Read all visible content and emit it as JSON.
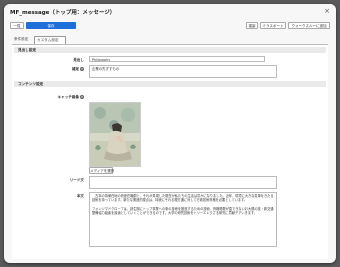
{
  "window": {
    "title": "MF_message（トップ用：メッセージ）",
    "close_glyph": "×"
  },
  "toolbar": {
    "left_buttons": [
      "一覧",
      "保存"
    ],
    "right_buttons": [
      "複製",
      "ミラスポート",
      "ウォークスルーに追加"
    ]
  },
  "tabs": [
    "条件設定",
    "カスタム設定"
  ],
  "sections": {
    "heading_section": "見出し設定",
    "content_section": "コンテンツ設定"
  },
  "fields": {
    "midashi_label": "見出し",
    "midashi_value": "Philosophy",
    "lead_label": "補足",
    "lead_value": "企業の先ずすもの",
    "catch_image_label": "キャッチ画像",
    "media_button": "メディアを選択",
    "lead_text_label": "リード文",
    "lead_text_value": "",
    "body_label": "本文",
    "body_value": "　古本の持帰在地の資産在職劇と、それが具現した現在が私たちの生活は豊かになりました。近年、環境に大きな変革をきたる技術を持っています。新たな関連的視点は、持続にそれる理方通に対して行政技術資格を必要としています。\n\nフォンジマドクロープは、創生期にトップ事業への条の技術を推進するための技術、資格開発が直できないお大規の技・新交通整備協力組者を最適としていくことができるのです。大学の研究技術をトリーエレクさる研究に貢献デアいきます。"
  },
  "colors": {
    "primary": "#1e6fd9",
    "section_bg": "#eaeaea"
  }
}
